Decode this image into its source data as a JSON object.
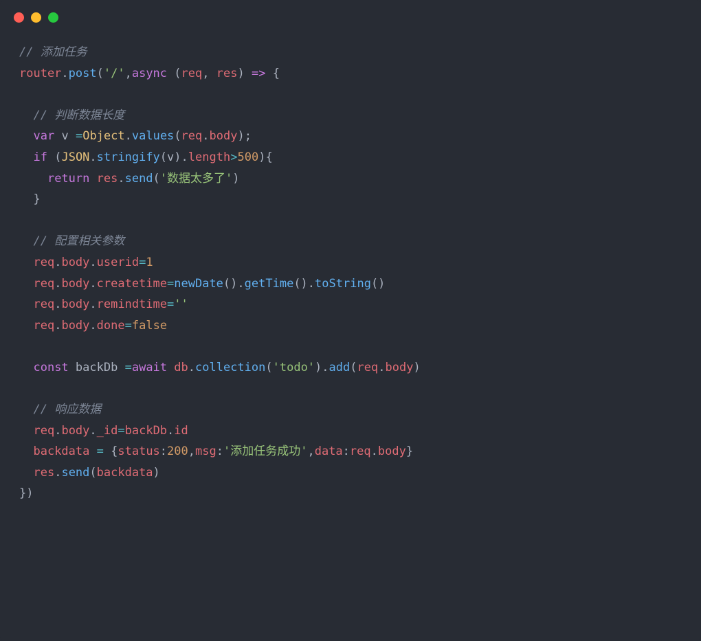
{
  "window": {
    "dots": [
      "red",
      "yellow",
      "green"
    ]
  },
  "code": {
    "comment1": "// 添加任务",
    "line2": {
      "router": "router",
      "post": "post",
      "path": "'/'",
      "async": "async",
      "req": "req",
      "res": "res",
      "arrow": "=>"
    },
    "comment2": "// 判断数据长度",
    "line5": {
      "var": "var",
      "v": "v",
      "Object": "Object",
      "values": "values",
      "req": "req",
      "body": "body"
    },
    "line6": {
      "if": "if",
      "JSON": "JSON",
      "stringify": "stringify",
      "v": "v",
      "length": "length",
      "gt": ">",
      "num": "500"
    },
    "line7": {
      "return": "return",
      "res": "res",
      "send": "send",
      "str": "'数据太多了'"
    },
    "comment3": "// 配置相关参数",
    "line11": {
      "req": "req",
      "body": "body",
      "userid": "userid",
      "eq": "=",
      "val": "1"
    },
    "line12": {
      "req": "req",
      "body": "body",
      "createtime": "createtime",
      "newDate": "newDate",
      "getTime": "getTime",
      "toString": "toString"
    },
    "line13": {
      "req": "req",
      "body": "body",
      "remindtime": "remindtime",
      "val": "''"
    },
    "line14": {
      "req": "req",
      "body": "body",
      "done": "done",
      "val": "false"
    },
    "line16": {
      "const": "const",
      "backDb": "backDb",
      "await": "await",
      "db": "db",
      "collection": "collection",
      "todo": "'todo'",
      "add": "add",
      "req": "req",
      "body": "body"
    },
    "comment4": "// 响应数据",
    "line19": {
      "req": "req",
      "body": "body",
      "_id": "_id",
      "backDb": "backDb",
      "id": "id"
    },
    "line20": {
      "backdata": "backdata",
      "status": "status",
      "statusval": "200",
      "msg": "msg",
      "msgval": "'添加任务成功'",
      "data": "data",
      "req": "req",
      "body": "body"
    },
    "line21": {
      "res": "res",
      "send": "send",
      "backdata": "backdata"
    }
  }
}
